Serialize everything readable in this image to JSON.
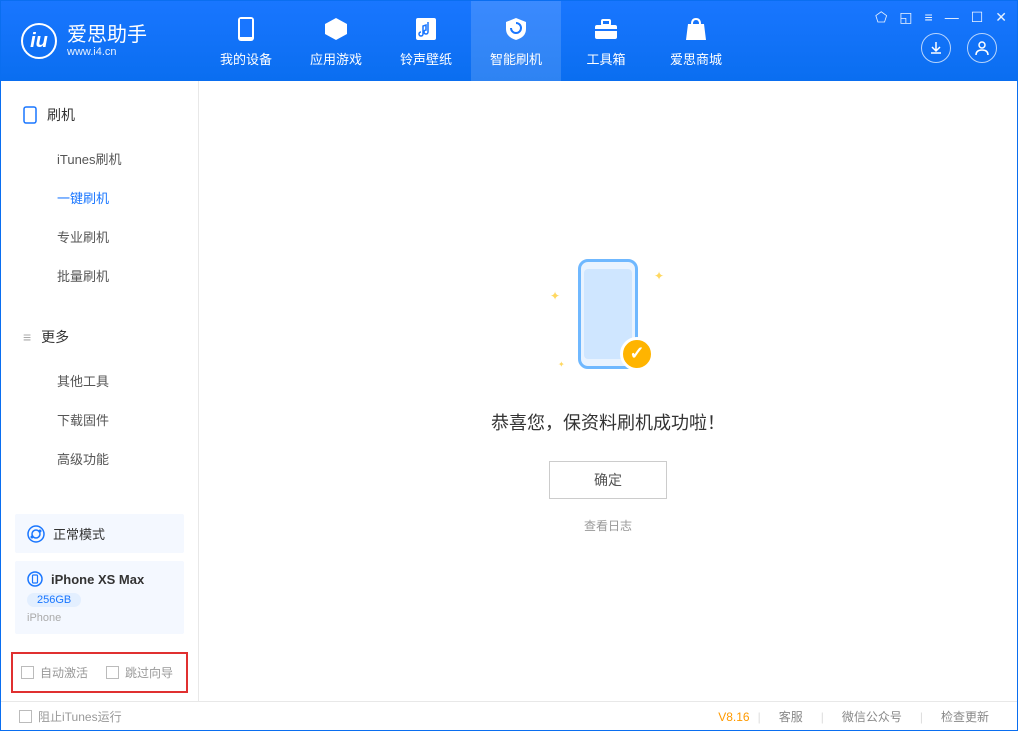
{
  "app": {
    "name": "爱思助手",
    "url": "www.i4.cn"
  },
  "nav": {
    "mydevice": "我的设备",
    "apps": "应用游戏",
    "ringtone": "铃声壁纸",
    "flash": "智能刷机",
    "toolbox": "工具箱",
    "store": "爱思商城"
  },
  "sidebar": {
    "section1_title": "刷机",
    "items1": {
      "itunes": "iTunes刷机",
      "oneclick": "一键刷机",
      "pro": "专业刷机",
      "batch": "批量刷机"
    },
    "section2_title": "更多",
    "items2": {
      "other": "其他工具",
      "firmware": "下载固件",
      "advanced": "高级功能"
    },
    "mode": "正常模式",
    "device": {
      "name": "iPhone XS Max",
      "storage": "256GB",
      "type": "iPhone"
    },
    "chk_activate": "自动激活",
    "chk_skip": "跳过向导"
  },
  "main": {
    "success_text": "恭喜您，保资料刷机成功啦！",
    "ok_button": "确定",
    "view_log": "查看日志"
  },
  "footer": {
    "block_itunes": "阻止iTunes运行",
    "version": "V8.16",
    "support": "客服",
    "wechat": "微信公众号",
    "update": "检查更新"
  }
}
